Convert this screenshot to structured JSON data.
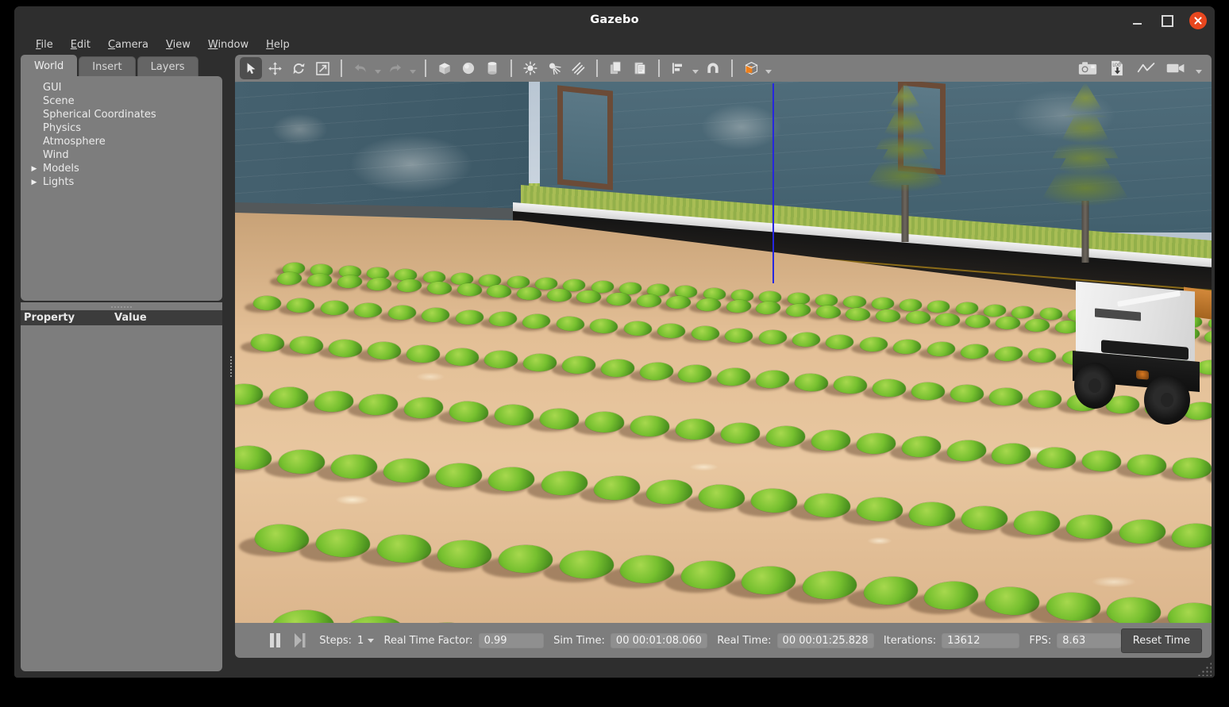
{
  "window": {
    "title": "Gazebo",
    "controls": [
      {
        "name": "minimize",
        "label": "–"
      },
      {
        "name": "maximize",
        "label": "□"
      },
      {
        "name": "close",
        "label": "×"
      }
    ]
  },
  "menubar": {
    "items": [
      {
        "label": "File",
        "accel": "F"
      },
      {
        "label": "Edit",
        "accel": "E"
      },
      {
        "label": "Camera",
        "accel": "C"
      },
      {
        "label": "View",
        "accel": "V"
      },
      {
        "label": "Window",
        "accel": "W"
      },
      {
        "label": "Help",
        "accel": "H"
      }
    ]
  },
  "left_panel": {
    "tabs": [
      {
        "label": "World",
        "active": true
      },
      {
        "label": "Insert",
        "active": false
      },
      {
        "label": "Layers",
        "active": false
      }
    ],
    "tree": [
      {
        "label": "GUI",
        "expandable": false
      },
      {
        "label": "Scene",
        "expandable": false
      },
      {
        "label": "Spherical Coordinates",
        "expandable": false
      },
      {
        "label": "Physics",
        "expandable": false
      },
      {
        "label": "Atmosphere",
        "expandable": false
      },
      {
        "label": "Wind",
        "expandable": false
      },
      {
        "label": "Models",
        "expandable": true
      },
      {
        "label": "Lights",
        "expandable": true
      }
    ],
    "property_table": {
      "columns": [
        "Property",
        "Value"
      ],
      "rows": []
    }
  },
  "toolbar": {
    "left_tools": [
      {
        "name": "select-mode-tool",
        "icon": "arrow-cursor-icon",
        "active": true
      },
      {
        "name": "translate-mode-tool",
        "icon": "move-arrows-icon",
        "active": false
      },
      {
        "name": "rotate-mode-tool",
        "icon": "rotate-icon",
        "active": false
      },
      {
        "name": "scale-mode-tool",
        "icon": "scale-icon",
        "active": false
      },
      {
        "name": "undo-tool",
        "icon": "undo-arrow-icon",
        "active": false
      },
      {
        "name": "undo-history-dropdown",
        "icon": "chevron-down-icon",
        "active": false
      },
      {
        "name": "redo-tool",
        "icon": "redo-arrow-icon",
        "active": false
      },
      {
        "name": "redo-history-dropdown",
        "icon": "chevron-down-icon",
        "active": false
      },
      {
        "name": "insert-box-tool",
        "icon": "box-icon",
        "active": false
      },
      {
        "name": "insert-sphere-tool",
        "icon": "sphere-icon",
        "active": false
      },
      {
        "name": "insert-cylinder-tool",
        "icon": "cylinder-icon",
        "active": false
      },
      {
        "name": "insert-point-light-tool",
        "icon": "point-light-icon",
        "active": false
      },
      {
        "name": "insert-spot-light-tool",
        "icon": "spot-light-icon",
        "active": false
      },
      {
        "name": "insert-directional-light-tool",
        "icon": "directional-light-icon",
        "active": false
      },
      {
        "name": "copy-tool",
        "icon": "copy-icon",
        "active": false
      },
      {
        "name": "paste-tool",
        "icon": "paste-icon",
        "active": false
      },
      {
        "name": "align-tool",
        "icon": "align-icon",
        "active": false
      },
      {
        "name": "snap-tool",
        "icon": "magnet-icon",
        "active": false
      },
      {
        "name": "view-mode-tool",
        "icon": "cube-faces-icon",
        "active": false
      }
    ],
    "right_tools": [
      {
        "name": "screenshot-tool",
        "icon": "camera-icon"
      },
      {
        "name": "log-record-tool",
        "icon": "log-download-icon",
        "label": "LOG"
      },
      {
        "name": "plot-tool",
        "icon": "line-chart-icon"
      },
      {
        "name": "video-record-tool",
        "icon": "video-camera-icon"
      }
    ]
  },
  "viewport": {
    "scene_name": "lettuce-field-simulation",
    "objects": [
      "building-wall",
      "window-frame",
      "road",
      "curb",
      "grass",
      "pine-tree",
      "soil-field",
      "lettuce-row",
      "ugv-robot",
      "z-axis-line"
    ]
  },
  "bottom_bar": {
    "pause_icon": "pause-icon",
    "step_icon": "step-forward-icon",
    "steps_label": "Steps:",
    "steps_value": "1",
    "rtf_label": "Real Time Factor:",
    "rtf_value": "0.99",
    "sim_time_label": "Sim Time:",
    "sim_time_value": "00 00:01:08.060",
    "real_time_label": "Real Time:",
    "real_time_value": "00 00:01:25.828",
    "iterations_label": "Iterations:",
    "iterations_value": "13612",
    "fps_label": "FPS:",
    "fps_value": "8.63",
    "reset_button": "Reset Time"
  },
  "colors": {
    "window_chrome": "#2e2e2e",
    "panel": "#7d7d7d",
    "panel_dark": "#3c3c3c",
    "accent_close": "#e8471f",
    "accent_orange": "#ef7f1a",
    "text": "#e8e8e8"
  }
}
